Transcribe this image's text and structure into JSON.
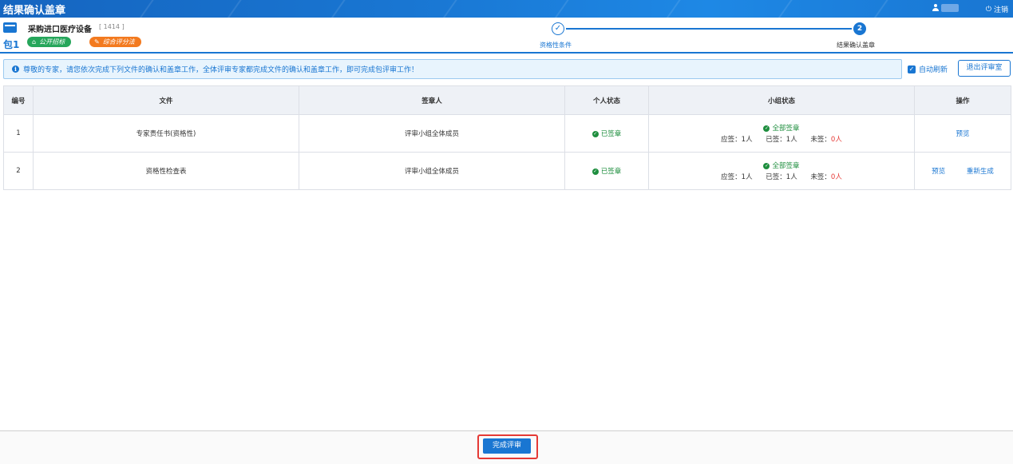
{
  "app": {
    "title": "结果确认盖章",
    "logout_label": "注销"
  },
  "project": {
    "name": "采购进口医疗设备",
    "id": "[ 1414 ]",
    "package": "包1"
  },
  "tags": {
    "method": "公开招标",
    "scoring": "综合评分法"
  },
  "steps": [
    {
      "number": "✓",
      "label": "资格性条件"
    },
    {
      "number": "2",
      "label": "结果确认盖章"
    }
  ],
  "notice": "尊敬的专家，请您依次完成下列文件的确认和盖章工作，全体评审专家都完成文件的确认和盖章工作，即可完成包评审工作！",
  "auto_refresh": {
    "label": "自动刷新",
    "checked": true
  },
  "exit_button": "退出评审室",
  "table": {
    "headers": [
      "编号",
      "文件",
      "签章人",
      "个人状态",
      "小组状态",
      "操作"
    ],
    "rows": [
      {
        "no": "1",
        "file": "专家责任书(资格性)",
        "signer": "评审小组全体成员",
        "personal": "已签章",
        "group_status": "全部签章",
        "should": "应签：1人",
        "signed": "已签：1人",
        "unsigned_label": "未签：",
        "unsigned_count": "0人",
        "actions": [
          "预览"
        ]
      },
      {
        "no": "2",
        "file": "资格性检查表",
        "signer": "评审小组全体成员",
        "personal": "已签章",
        "group_status": "全部签章",
        "should": "应签：1人",
        "signed": "已签：1人",
        "unsigned_label": "未签：",
        "unsigned_count": "0人",
        "actions": [
          "预览",
          "重新生成"
        ]
      }
    ]
  },
  "footer": {
    "finish_button": "完成评审"
  },
  "colors": {
    "primary": "#1976d2",
    "success": "#1e8e3e",
    "danger": "#e53935",
    "tag_green": "#26a65b",
    "tag_orange": "#f37a1f"
  }
}
